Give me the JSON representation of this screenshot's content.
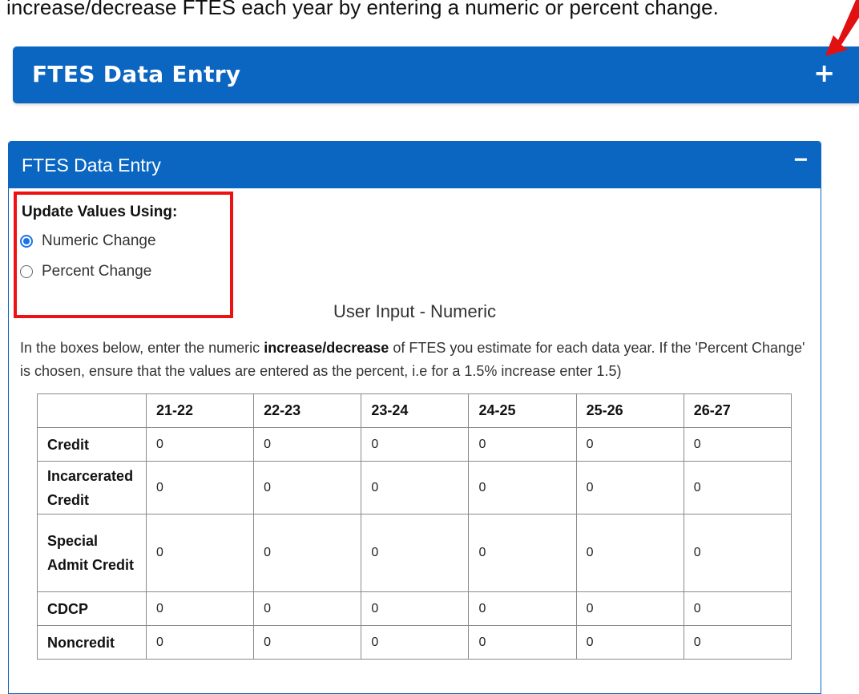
{
  "intro": "increase/decrease FTES each year by entering a numeric or percent change.",
  "collapsed_panel": {
    "title": "FTES Data Entry",
    "toggle": "+"
  },
  "panel": {
    "title": "FTES Data Entry",
    "toggle": "−",
    "update_label": "Update Values Using:",
    "options": [
      {
        "label": "Numeric Change",
        "selected": true
      },
      {
        "label": "Percent Change",
        "selected": false
      }
    ],
    "section_heading": "User Input - Numeric",
    "instructions": {
      "before": "In the boxes below, enter the numeric ",
      "bold": "increase/decrease",
      "after": " of FTES you estimate for each data year. If the 'Percent Change' is chosen, ensure that the values are entered as the percent, i.e for a 1.5% increase enter 1.5)"
    }
  },
  "table": {
    "columns": [
      "",
      "21-22",
      "22-23",
      "23-24",
      "24-25",
      "25-26",
      "26-27"
    ],
    "rows": [
      {
        "label": "Credit",
        "values": [
          "0",
          "0",
          "0",
          "0",
          "0",
          "0"
        ]
      },
      {
        "label": "Incarcerated Credit",
        "values": [
          "0",
          "0",
          "0",
          "0",
          "0",
          "0"
        ]
      },
      {
        "label": "Special Admit Credit",
        "values": [
          "0",
          "0",
          "0",
          "0",
          "0",
          "0"
        ]
      },
      {
        "label": "CDCP",
        "values": [
          "0",
          "0",
          "0",
          "0",
          "0",
          "0"
        ]
      },
      {
        "label": "Noncredit",
        "values": [
          "0",
          "0",
          "0",
          "0",
          "0",
          "0"
        ]
      }
    ]
  },
  "colors": {
    "panel_blue": "#0b66c1",
    "highlight_red": "#e11111",
    "radio_blue": "#1a73e8"
  },
  "icons": {
    "collapsed_toggle": "plus-icon",
    "panel_toggle": "minus-icon",
    "annotation": "red-arrow-icon"
  }
}
